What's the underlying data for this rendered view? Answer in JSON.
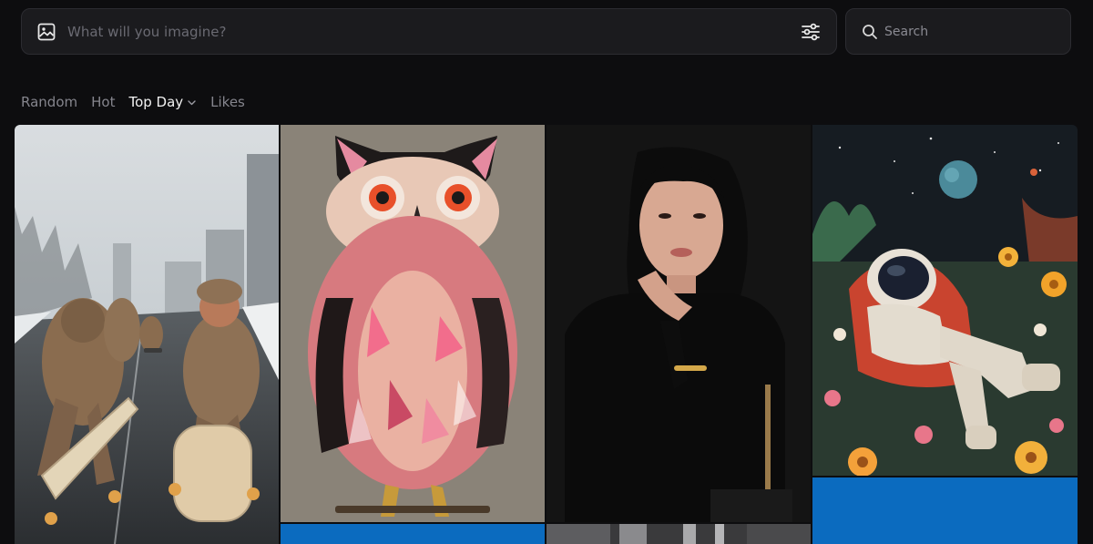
{
  "prompt": {
    "placeholder": "What will you imagine?",
    "image_icon": "image-icon",
    "settings_icon": "sliders-icon"
  },
  "search": {
    "placeholder": "Search",
    "icon": "search-icon"
  },
  "tabs": [
    {
      "label": "Random",
      "active": false
    },
    {
      "label": "Hot",
      "active": false
    },
    {
      "label": "Top Day",
      "active": true,
      "icon": "chevron-down-icon"
    },
    {
      "label": "Likes",
      "active": false
    }
  ],
  "gallery": {
    "items": [
      {
        "subject": "monkeys-skateboarding"
      },
      {
        "subject": "pink-feathered-owl"
      },
      {
        "subject": "woman-portrait"
      },
      {
        "subject": "astronaut-in-flowers"
      },
      {
        "subject": "blue-tile"
      },
      {
        "subject": "grey-architecture"
      },
      {
        "subject": "blue-tile"
      }
    ]
  },
  "colors": {
    "background": "#0d0d0f",
    "panel": "#1b1b1e",
    "tile_blue": "#0b6bbf"
  }
}
